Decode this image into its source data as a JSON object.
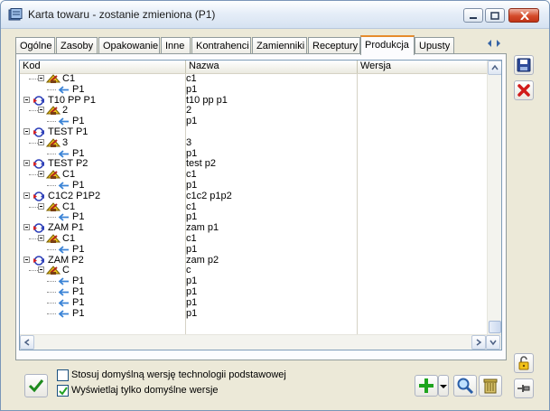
{
  "window": {
    "title": "Karta towaru - zostanie zmieniona (P1)",
    "accent": "#e68b2c"
  },
  "tabs": [
    {
      "label": "Ogólne"
    },
    {
      "label": "Zasoby"
    },
    {
      "label": "Opakowanie"
    },
    {
      "label": "Inne"
    },
    {
      "label": "Kontrahenci"
    },
    {
      "label": "Zamienniki"
    },
    {
      "label": "Receptury"
    },
    {
      "label": "Produkcja",
      "active": true
    },
    {
      "label": "Upusty"
    }
  ],
  "columns": {
    "kod": "Kod",
    "nazwa": "Nazwa",
    "wersja": "Wersja"
  },
  "rows": [
    {
      "kind": "version",
      "kod": "C1",
      "nazwa": "c1"
    },
    {
      "kind": "item",
      "kod": "P1",
      "nazwa": "p1"
    },
    {
      "kind": "tech",
      "kod": "T10 PP P1",
      "nazwa": "t10 pp p1"
    },
    {
      "kind": "version",
      "kod": "2",
      "nazwa": "2"
    },
    {
      "kind": "item",
      "kod": "P1",
      "nazwa": "p1"
    },
    {
      "kind": "tech",
      "kod": "TEST P1",
      "nazwa": ""
    },
    {
      "kind": "version",
      "kod": "3",
      "nazwa": "3"
    },
    {
      "kind": "item",
      "kod": "P1",
      "nazwa": "p1"
    },
    {
      "kind": "tech",
      "kod": "TEST P2",
      "nazwa": "test p2"
    },
    {
      "kind": "version",
      "kod": "C1",
      "nazwa": "c1"
    },
    {
      "kind": "item",
      "kod": "P1",
      "nazwa": "p1"
    },
    {
      "kind": "tech",
      "kod": "C1C2 P1P2",
      "nazwa": "c1c2 p1p2"
    },
    {
      "kind": "version",
      "kod": "C1",
      "nazwa": "c1"
    },
    {
      "kind": "item",
      "kod": "P1",
      "nazwa": "p1"
    },
    {
      "kind": "tech",
      "kod": "ZAM P1",
      "nazwa": "zam p1"
    },
    {
      "kind": "version",
      "kod": "C1",
      "nazwa": "c1"
    },
    {
      "kind": "item",
      "kod": "P1",
      "nazwa": "p1"
    },
    {
      "kind": "tech",
      "kod": "ZAM P2",
      "nazwa": "zam p2"
    },
    {
      "kind": "version",
      "kod": "C",
      "nazwa": "c"
    },
    {
      "kind": "item",
      "kod": "P1",
      "nazwa": "p1"
    },
    {
      "kind": "item",
      "kod": "P1",
      "nazwa": "p1"
    },
    {
      "kind": "item",
      "kod": "P1",
      "nazwa": "p1"
    },
    {
      "kind": "item",
      "kod": "P1",
      "nazwa": "p1"
    }
  ],
  "options": {
    "default_tech_version": {
      "label": "Stosuj domyślną wersję technologii podstawowej",
      "checked": false
    },
    "show_default_only": {
      "label": "Wyświetlaj tylko domyślne wersje",
      "checked": true
    }
  }
}
